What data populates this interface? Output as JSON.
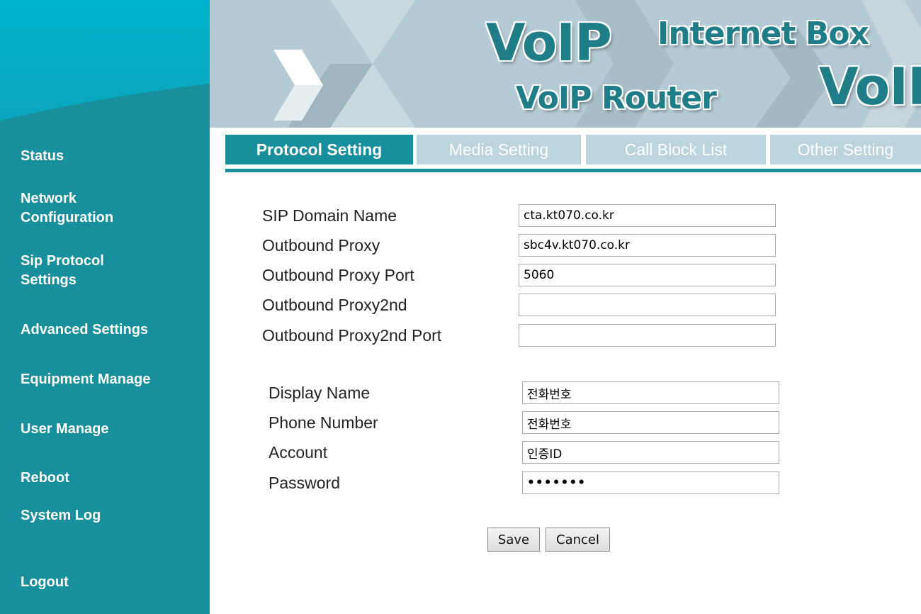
{
  "banner": {
    "voip_large": "VoIP",
    "internet_box": "Internet Box",
    "voip_router": "VoIP Router",
    "voip_right": "VoIP"
  },
  "sidebar": {
    "items": [
      {
        "label": "Status"
      },
      {
        "label": "Network\nConfiguration"
      },
      {
        "label": "Sip Protocol\nSettings"
      },
      {
        "label": "Advanced Settings"
      },
      {
        "label": "Equipment Manage"
      },
      {
        "label": "User Manage"
      },
      {
        "label": "Reboot"
      },
      {
        "label": "System Log"
      },
      {
        "label": "Logout"
      }
    ]
  },
  "tabs": [
    {
      "label": "Protocol Setting",
      "active": true
    },
    {
      "label": "Media Setting",
      "active": false
    },
    {
      "label": "Call Block List",
      "active": false
    },
    {
      "label": "Other Setting",
      "active": false
    }
  ],
  "proxy_section": {
    "fields": [
      {
        "label": "SIP Domain Name",
        "value": "cta.kt070.co.kr"
      },
      {
        "label": "Outbound Proxy",
        "value": "sbc4v.kt070.co.kr"
      },
      {
        "label": "Outbound Proxy Port",
        "value": "5060"
      },
      {
        "label": "Outbound Proxy2nd",
        "value": ""
      },
      {
        "label": "Outbound Proxy2nd Port",
        "value": ""
      }
    ]
  },
  "account_section": {
    "fields": [
      {
        "label": "Display Name",
        "value": "전화번호"
      },
      {
        "label": "Phone Number",
        "value": "전화번호"
      },
      {
        "label": "Account",
        "value": "인증ID"
      },
      {
        "label": "Password",
        "value": "•••••••"
      }
    ]
  },
  "buttons": {
    "save": "Save",
    "cancel": "Cancel"
  },
  "colors": {
    "sidebar": "#178f9c",
    "active_tab": "#178f9c",
    "inactive_tab": "#bcd4de",
    "banner": "#b4cad4"
  }
}
